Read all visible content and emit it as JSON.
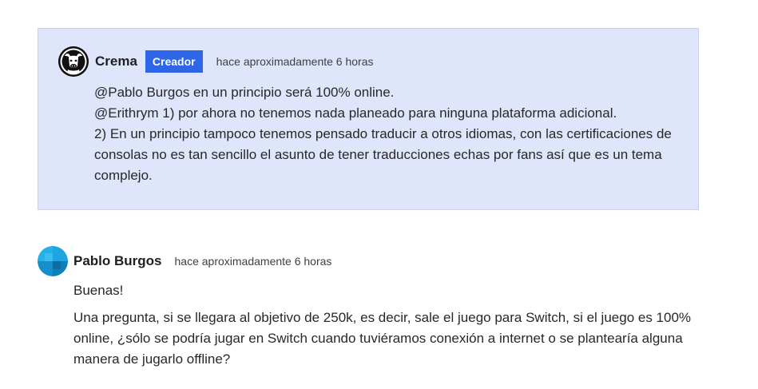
{
  "creator_comment": {
    "author": "Crema",
    "badge": "Creador",
    "timestamp": "hace aproximadamente 6 horas",
    "lines": [
      "@Pablo Burgos en un principio será 100% online.",
      "@Erithrym 1) por ahora no tenemos nada planeado para ninguna plataforma adicional.",
      "2) En un principio tampoco tenemos pensado traducir a otros idiomas, con las certificaciones de consolas no es tan sencillo el asunto de tener traducciones echas por fans así que es un tema complejo."
    ],
    "avatar_icon": "bull-logo-icon",
    "background_color": "#dfe6fb",
    "badge_color": "#2f66e8"
  },
  "user_comment": {
    "author": "Pablo Burgos",
    "timestamp": "hace aproximadamente 6 horas",
    "paragraphs": [
      "Buenas!",
      "Una pregunta, si se llegara al objetivo de 250k, es decir, sale el juego para Switch, si el juego es 100% online, ¿sólo se podría jugar en Switch cuando tuviéramos conexión a internet o se plantearía alguna manera de jugarlo offline?"
    ],
    "avatar_icon": "default-avatar-icon",
    "avatar_color": "#1b9ad6"
  }
}
